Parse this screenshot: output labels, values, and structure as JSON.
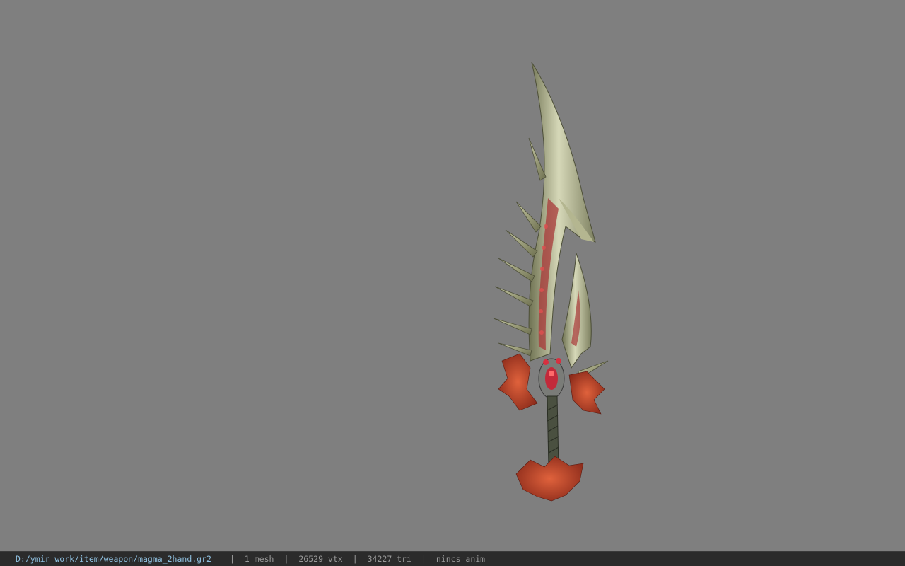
{
  "viewer": {
    "background_color": "#7f7f7f",
    "model_icon": "sword-model"
  },
  "status_bar": {
    "file_path": "D:/ymir work/item/weapon/magma_2hand.gr2",
    "separator": "|",
    "mesh_count": "1 mesh",
    "vertex_count": "26529 vtx",
    "triangle_count": "34227 tri",
    "animation": "nincs anim",
    "path_color": "#8fc0e0",
    "text_color": "#9a9a9a"
  }
}
